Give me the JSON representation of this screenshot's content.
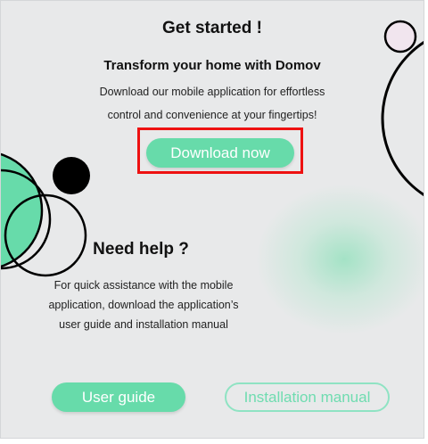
{
  "hero": {
    "title": "Get started !",
    "subtitle": "Transform your home with Domov",
    "description_line1": "Download our mobile application for effortless",
    "description_line2": "control and convenience at your fingertips!",
    "download_label": "Download now"
  },
  "help": {
    "title": "Need help ?",
    "description_line1": "For quick assistance with the mobile",
    "description_line2": "application, download the application’s",
    "description_line3": "user guide and installation manual",
    "user_guide_label": "User guide",
    "installation_manual_label": "Installation manual"
  },
  "colors": {
    "accent": "#67dbaa",
    "background": "#e8e9ea",
    "highlight_border": "#ee1111",
    "heading_text": "#111111",
    "body_text": "#222222",
    "decor_black": "#000000",
    "decor_pink": "#f1e5ee"
  }
}
